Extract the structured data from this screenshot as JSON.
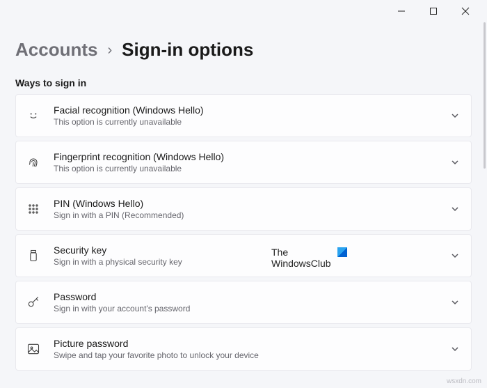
{
  "breadcrumb": {
    "parent": "Accounts",
    "title": "Sign-in options"
  },
  "section_label": "Ways to sign in",
  "options": [
    {
      "title": "Facial recognition (Windows Hello)",
      "desc": "This option is currently unavailable"
    },
    {
      "title": "Fingerprint recognition (Windows Hello)",
      "desc": "This option is currently unavailable"
    },
    {
      "title": "PIN (Windows Hello)",
      "desc": "Sign in with a PIN (Recommended)"
    },
    {
      "title": "Security key",
      "desc": "Sign in with a physical security key"
    },
    {
      "title": "Password",
      "desc": "Sign in with your account's password"
    },
    {
      "title": "Picture password",
      "desc": "Swipe and tap your favorite photo to unlock your device"
    }
  ],
  "watermark": {
    "line1": "The",
    "line2": "WindowsClub"
  },
  "credit": "wsxdn.com"
}
